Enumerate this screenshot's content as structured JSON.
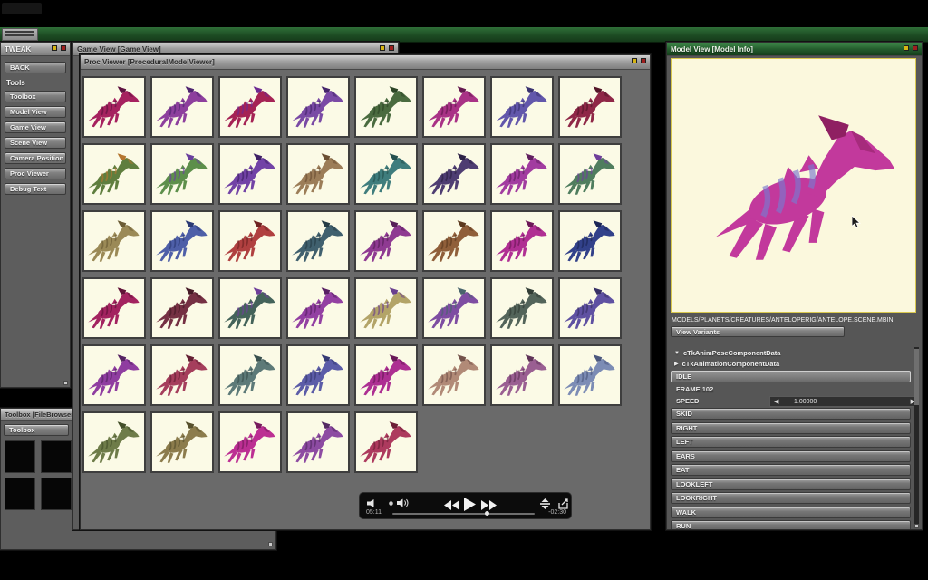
{
  "tweak": {
    "title": "TWEAK",
    "back": "BACK",
    "tools_label": "Tools",
    "buttons": [
      "Toolbox",
      "Model View",
      "Game View",
      "Scene View",
      "Camera Position",
      "Proc Viewer",
      "Debug Text"
    ]
  },
  "game_view": {
    "title": "Game View  [Game View]"
  },
  "proc_viewer": {
    "title": "Proc Viewer  [ProceduralModelViewer]"
  },
  "toolbox": {
    "title": "Toolbox  [FileBrowser]",
    "button_label": "Toolbox"
  },
  "model_view": {
    "title": "Model View  [Model Info]",
    "path": "MODELS/PLANETS/CREATURES/ANTELOPERIG/ANTELOPE.SCENE.MBIN",
    "view_variants": "View Variants",
    "components": [
      {
        "label": "cTkAnimPoseComponentData",
        "expanded": true
      },
      {
        "label": "cTkAnimationComponentData",
        "expanded": false
      }
    ],
    "selected_anim": "IDLE",
    "frame_label": "FRAME 102",
    "speed_label": "SPEED",
    "speed_value": "1.00000",
    "anims": [
      "SKID",
      "RIGHT",
      "LEFT",
      "EARS",
      "EAT",
      "LOOKLEFT",
      "LOOKRIGHT",
      "WALK",
      "RUN"
    ]
  },
  "player": {
    "elapsed": "05:11",
    "remaining": "-02:30",
    "progress_pct": 66
  },
  "creatures": {
    "big": {
      "b": "#c2399c",
      "s": "#7b79cf",
      "c": "#8f2062"
    },
    "thumbs": [
      {
        "b": "#a6215f",
        "s": "#5e1240"
      },
      {
        "b": "#8d3f9d",
        "s": "#4f2470"
      },
      {
        "b": "#a52355",
        "s": "#6d2a92"
      },
      {
        "b": "#7a4aa5",
        "s": "#45256b"
      },
      {
        "b": "#4a6b3f",
        "s": "#2c4526"
      },
      {
        "b": "#a93286",
        "s": "#64184f"
      },
      {
        "b": "#6257ab",
        "s": "#3a3270"
      },
      {
        "b": "#8f2747",
        "s": "#541529"
      },
      {
        "b": "#5f7e3e",
        "s": "#b5762f"
      },
      {
        "b": "#5d8f4b",
        "s": "#6a3f9e"
      },
      {
        "b": "#7243a6",
        "s": "#3f2066"
      },
      {
        "b": "#9c7d58",
        "s": "#6b4f33"
      },
      {
        "b": "#3f7d7d",
        "s": "#24514f"
      },
      {
        "b": "#4e3d72",
        "s": "#2c2145"
      },
      {
        "b": "#a23ca0",
        "s": "#611f60"
      },
      {
        "b": "#4f7d5e",
        "s": "#6f3f9a"
      },
      {
        "b": "#9b8a57",
        "s": "#6b5c35"
      },
      {
        "b": "#4e5fa8",
        "s": "#2b3a74"
      },
      {
        "b": "#b04040",
        "s": "#702222"
      },
      {
        "b": "#40606e",
        "s": "#263d47"
      },
      {
        "b": "#8f3a92",
        "s": "#571f59"
      },
      {
        "b": "#905f3a",
        "s": "#5c3a1f"
      },
      {
        "b": "#b02f93",
        "s": "#6d1858"
      },
      {
        "b": "#32418a",
        "s": "#1c2657"
      },
      {
        "b": "#a32360",
        "s": "#611238"
      },
      {
        "b": "#753043",
        "s": "#461a26"
      },
      {
        "b": "#44635a",
        "s": "#6f3f9a"
      },
      {
        "b": "#9340a2",
        "s": "#582063"
      },
      {
        "b": "#b3a468",
        "s": "#6a3f8e"
      },
      {
        "b": "#7e4da2",
        "s": "#49646c"
      },
      {
        "b": "#53645a",
        "s": "#323d36"
      },
      {
        "b": "#5f51a2",
        "s": "#383066"
      },
      {
        "b": "#8f3da0",
        "s": "#562363"
      },
      {
        "b": "#a53e5c",
        "s": "#641f33"
      },
      {
        "b": "#5d7a78",
        "s": "#39504e"
      },
      {
        "b": "#5c5da8",
        "s": "#363a74"
      },
      {
        "b": "#ad2f92",
        "s": "#6a1858"
      },
      {
        "b": "#b18a77",
        "s": "#73524a"
      },
      {
        "b": "#9a5f92",
        "s": "#5f3358"
      },
      {
        "b": "#7c8cb5",
        "s": "#4c587e"
      },
      {
        "b": "#6e7c49",
        "s": "#44502a"
      },
      {
        "b": "#8c7c4c",
        "s": "#57502c"
      },
      {
        "b": "#bc2f93",
        "s": "#771b5d"
      },
      {
        "b": "#8d4ba2",
        "s": "#552a64"
      },
      {
        "b": "#ad3a5e",
        "s": "#6d1f37"
      }
    ]
  },
  "colors": {
    "accent_green": "#245d2d",
    "title_yellow": "#d6b514",
    "title_red": "#9e1f1f",
    "viewport_cream": "#fbf8dd"
  }
}
